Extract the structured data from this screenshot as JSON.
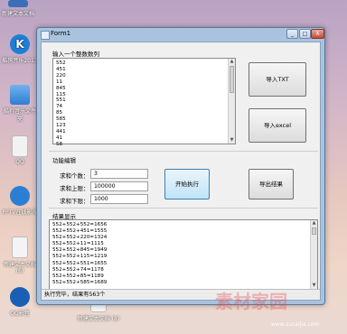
{
  "window": {
    "title": "Form1",
    "btn_min": "_",
    "btn_max": "□",
    "btn_close": "X"
  },
  "input_section": {
    "label": "输入一个整数数列",
    "numbers": [
      "552",
      "451",
      "220",
      "11",
      "845",
      "115",
      "551",
      "74",
      "85",
      "585",
      "123",
      "441",
      "41",
      "58"
    ]
  },
  "buttons": {
    "import_txt": "导入TXT",
    "import_excel": "导入excel",
    "start": "开始执行",
    "export": "导出结果"
  },
  "function_section": {
    "label": "功能编辑",
    "sum_count_label": "求和个数：",
    "sum_count_value": "3",
    "upper_label": "求和上限：",
    "upper_value": "100000",
    "lower_label": "求和下限：",
    "lower_value": "1000"
  },
  "result_section": {
    "label": "结果显示",
    "lines": [
      "552+552+552=1656",
      "552+552+451=1555",
      "552+552+220=1324",
      "552+552+11=1115",
      "552+552+845=1949",
      "552+552+115=1219",
      "552+552+551=1655",
      "552+552+74=1178",
      "552+552+85=1189",
      "552+552+585=1689"
    ]
  },
  "status": {
    "text": "执行完毕，结果有563个"
  },
  "desktop_icons": [
    {
      "label": "新建文本文档",
      "color": "#3a6fb8"
    },
    {
      "label": "酷狗音乐2013",
      "color": "#1f7fd6"
    },
    {
      "label": "酷狗音乐文件夹",
      "color": "#3d8de0"
    },
    {
      "label": "QQ",
      "color": "#f2f2f2"
    },
    {
      "label": "PPTV在线影视",
      "color": "#2a7fd3"
    },
    {
      "label": "新建文本文档 (6)",
      "color": "#f4f4f4"
    },
    {
      "label": "QQ影音",
      "color": "#1a5fb4"
    },
    {
      "label": "新建文本文档 (8)",
      "color": "#f4f4f4"
    }
  ],
  "watermark": {
    "text": "素材家园",
    "url": "www.sucaijia.com"
  }
}
